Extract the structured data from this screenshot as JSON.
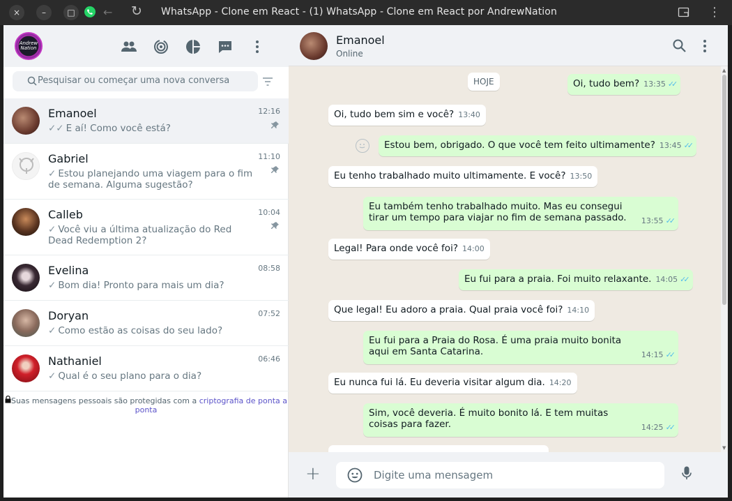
{
  "window": {
    "title": "WhatsApp - Clone em React - (1) WhatsApp - Clone em React por AndrewNation",
    "close_icon": "×",
    "minimize_icon": "–",
    "maximize_icon": "□",
    "back_icon": "←",
    "reload_icon": "↻",
    "menu_icon": "⋮"
  },
  "profile": {
    "avatar_text": "Andrew Nation"
  },
  "search": {
    "placeholder": "Pesquisar ou começar uma nova conversa"
  },
  "chats": [
    {
      "name": "Emanoel",
      "time": "12:16",
      "tick": "✓✓",
      "preview": "E aí! Como você está?",
      "pinned": true,
      "active": true
    },
    {
      "name": "Gabriel",
      "time": "11:10",
      "tick": "✓",
      "preview": "Estou planejando uma viagem para o fim de semana. Alguma sugestão?",
      "pinned": true
    },
    {
      "name": "Calleb",
      "time": "10:04",
      "tick": "✓",
      "preview": "Você viu a última atualização do Red Dead Redemption 2?",
      "pinned": true
    },
    {
      "name": "Evelina",
      "time": "08:58",
      "tick": "✓",
      "preview": "Bom dia! Pronto para mais um dia?"
    },
    {
      "name": "Doryan",
      "time": "07:52",
      "tick": "✓",
      "preview": "Como estão as coisas do seu lado?"
    },
    {
      "name": "Nathaniel",
      "time": "06:46",
      "tick": "✓",
      "preview": "Qual é o seu plano para o dia?"
    }
  ],
  "encryption": {
    "text": "Suas mensagens pessoais são protegidas com a ",
    "link": "criptografia de ponta a ponta"
  },
  "contact": {
    "name": "Emanoel",
    "status": "Online"
  },
  "date_pill": "HOJE",
  "messages": [
    {
      "dir": "out",
      "text": "Oi, tudo bem?",
      "time": "13:35"
    },
    {
      "dir": "in",
      "text": "Oi, tudo bem sim e você?",
      "time": "13:40"
    },
    {
      "dir": "out",
      "text": "Estou bem, obrigado. O que você tem feito ultimamente?",
      "time": "13:45"
    },
    {
      "dir": "in",
      "text": "Eu tenho trabalhado muito ultimamente. E você?",
      "time": "13:50"
    },
    {
      "dir": "out",
      "text": "Eu também tenho trabalhado muito. Mas eu consegui tirar um tempo para viajar no fim de semana passado.",
      "time": "13:55"
    },
    {
      "dir": "in",
      "text": "Legal! Para onde você foi?",
      "time": "14:00"
    },
    {
      "dir": "out",
      "text": "Eu fui para a praia. Foi muito relaxante.",
      "time": "14:05"
    },
    {
      "dir": "in",
      "text": "Que legal! Eu adoro a praia. Qual praia você foi?",
      "time": "14:10"
    },
    {
      "dir": "out",
      "text": "Eu fui para a Praia do Rosa. É uma praia muito bonita aqui em Santa Catarina.",
      "time": "14:15"
    },
    {
      "dir": "in",
      "text": "Eu nunca fui lá. Eu deveria visitar algum dia.",
      "time": "14:20"
    },
    {
      "dir": "out",
      "text": "Sim, você deveria. É muito bonito lá. E tem muitas coisas para fazer.",
      "time": "14:25"
    }
  ],
  "ticks": "✓✓",
  "composer": {
    "placeholder": "Digite uma mensagem",
    "plus": "+"
  },
  "colors": {
    "outgoing": "#d9fdd3",
    "incoming": "#ffffff",
    "background": "#efeae2",
    "tick_read": "#53bdeb"
  }
}
